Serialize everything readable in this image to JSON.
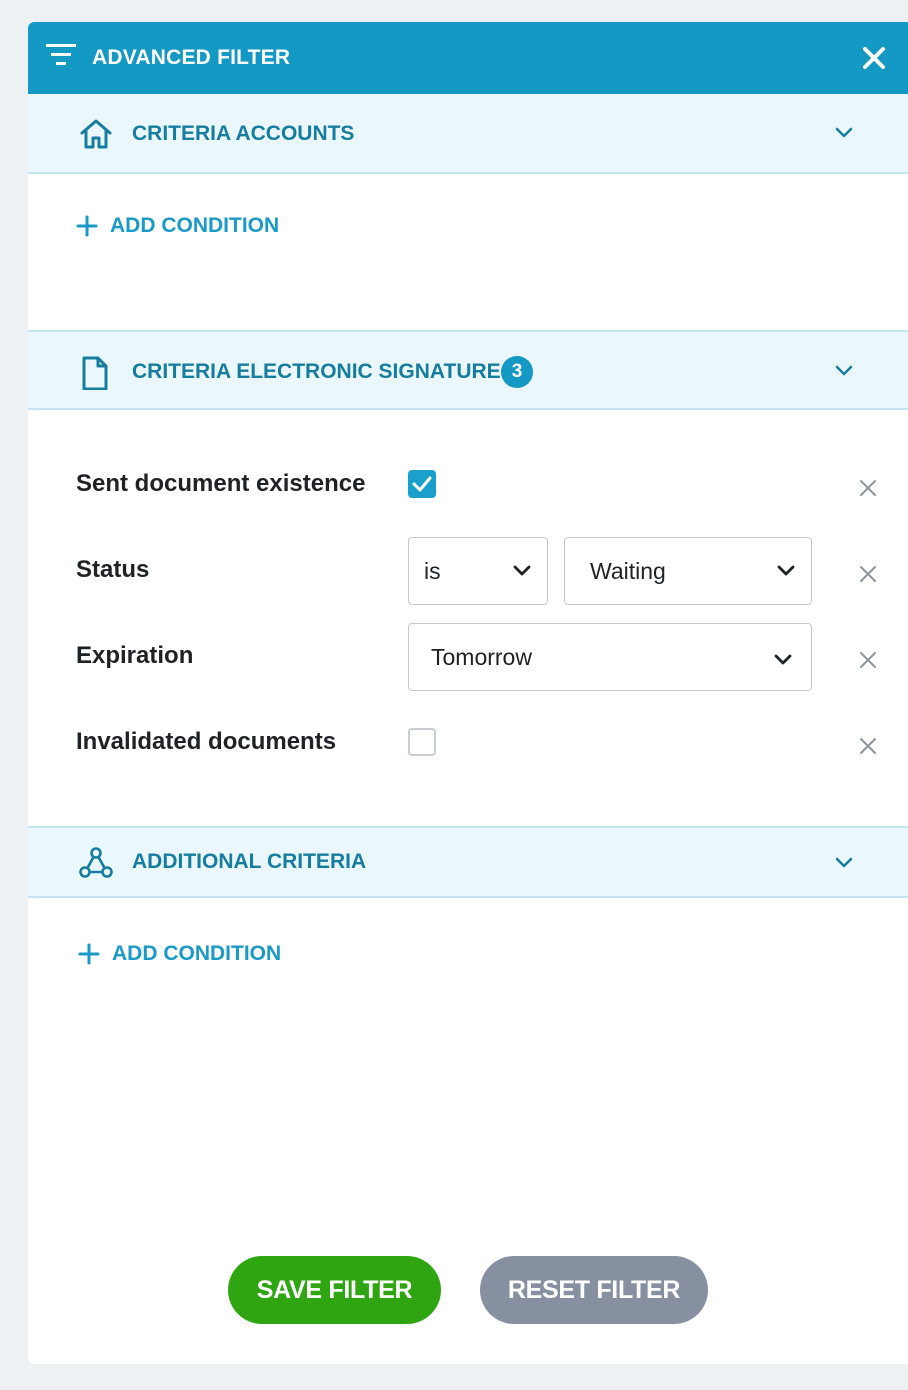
{
  "header": {
    "title": "ADVANCED FILTER",
    "icon": "filter-lines-icon",
    "close_icon": "close-icon"
  },
  "sections": {
    "accounts": {
      "title": "CRITERIA ACCOUNTS",
      "icon": "home-icon",
      "add_condition_label": "ADD CONDITION"
    },
    "esign": {
      "title": "CRITERIA ELECTRONIC SIGNATURE",
      "icon": "document-icon",
      "badge": "3",
      "rows": {
        "sent": {
          "label": "Sent document existence",
          "checked": true
        },
        "status": {
          "label": "Status",
          "operator": "is",
          "value": "Waiting"
        },
        "expiration": {
          "label": "Expiration",
          "value": "Tomorrow"
        },
        "invalidated": {
          "label": "Invalidated documents",
          "checked": false
        }
      }
    },
    "additional": {
      "title": "ADDITIONAL CRITERIA",
      "icon": "network-nodes-icon",
      "add_condition_label": "ADD CONDITION"
    }
  },
  "buttons": {
    "save": "SAVE FILTER",
    "reset": "RESET FILTER"
  },
  "colors": {
    "header_bg": "#1399c4",
    "section_bg": "#eaf8fd",
    "accent_text": "#167da0",
    "save_bg": "#2fa611",
    "reset_bg": "#8790a0"
  }
}
